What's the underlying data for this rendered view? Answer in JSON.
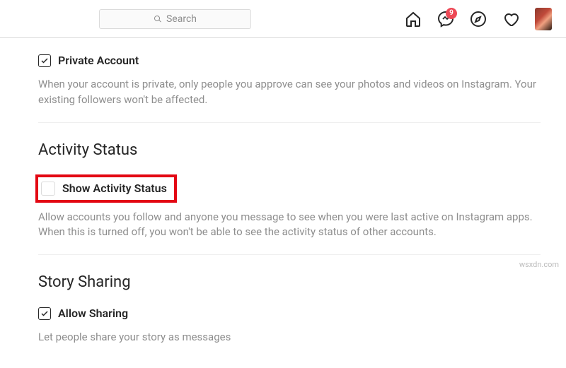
{
  "header": {
    "search_placeholder": "Search",
    "badge_count": "9"
  },
  "sections": {
    "private": {
      "checkbox_label": "Private Account",
      "checked": true,
      "description": "When your account is private, only people you approve can see your photos and videos on Instagram. Your existing followers won't be affected."
    },
    "activity": {
      "title": "Activity Status",
      "checkbox_label": "Show Activity Status",
      "checked": false,
      "description": "Allow accounts you follow and anyone you message to see when you were last active on Instagram apps. When this is turned off, you won't be able to see the activity status of other accounts."
    },
    "story": {
      "title": "Story Sharing",
      "checkbox_label": "Allow Sharing",
      "checked": true,
      "description": "Let people share your story as messages"
    }
  },
  "watermark": "wsxdn.com"
}
